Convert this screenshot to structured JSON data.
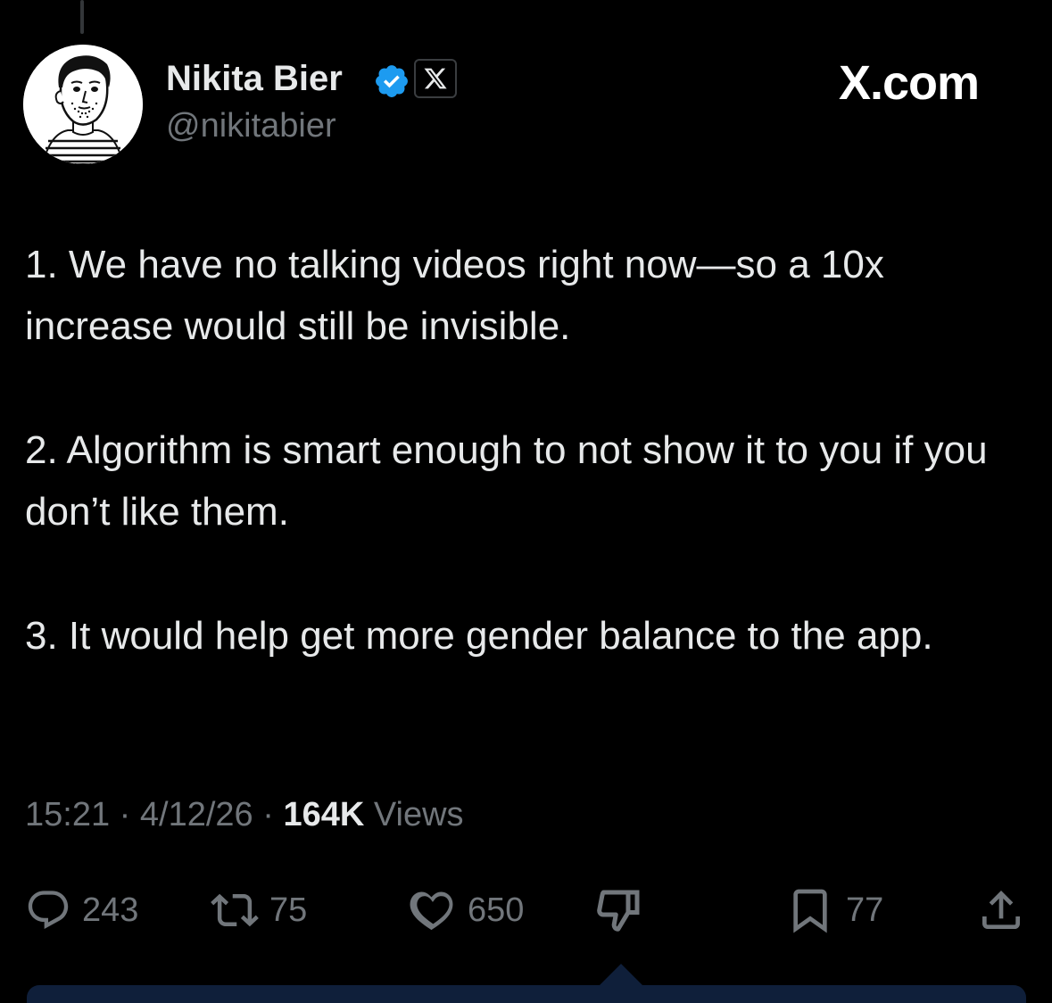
{
  "author": {
    "name": "Nikita Bier",
    "handle": "@nikitabier",
    "verified_color": "#1d9bf0",
    "avatar_icon": "cartoon-portrait"
  },
  "watermark": "X.com",
  "tweet": {
    "paragraphs": [
      "1. We have no talking videos right now—so a 10x increase would still be invisible.",
      "2. Algorithm is smart enough to not show it to you if you don’t like them.",
      "3. It would help get more gender balance to the app."
    ]
  },
  "meta": {
    "time": "15:21",
    "sep1": " · ",
    "date": "4/12/26",
    "sep2": " · ",
    "views_count": "164K",
    "views_label": " Views"
  },
  "actions": {
    "replies": "243",
    "reposts": "75",
    "likes": "650",
    "bookmarks": "77"
  },
  "colors": {
    "background": "#000000",
    "text": "#e7e9ea",
    "muted": "#71767b",
    "accent": "#1d9bf0"
  }
}
